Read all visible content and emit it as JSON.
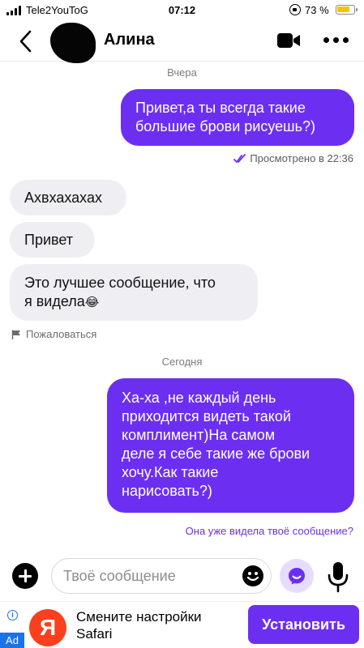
{
  "status_bar": {
    "carrier": "Tele2YouToG",
    "time": "07:12",
    "battery_percent": "73 %",
    "battery_color": "#f2c500"
  },
  "header": {
    "contact_name": "Алина",
    "back_icon": "chevron-left-icon",
    "video_icon": "video-camera-icon",
    "more_icon": "more-horizontal-icon"
  },
  "chat": {
    "date_yesterday": "Вчера",
    "date_today": "Сегодня",
    "messages": [
      {
        "direction": "out",
        "lines": [
          "Привет,а ты всегда такие",
          "большие брови рисуешь?)"
        ]
      },
      {
        "direction": "in",
        "lines": [
          "Ахвхахахах"
        ]
      },
      {
        "direction": "in",
        "lines": [
          "Привет"
        ]
      },
      {
        "direction": "in",
        "lines": [
          "Это лучшее сообщение, что",
          "я видела"
        ],
        "emoji": "😂"
      },
      {
        "direction": "out",
        "lines": [
          "Ха-ха ,не каждый день",
          "приходится видеть такой",
          "комплимент)На самом",
          "деле я себе такие же брови",
          "хочу.Как такие",
          "нарисовать?)"
        ]
      }
    ],
    "seen_status": "Просмотрено в 22:36",
    "report_link": "Пожаловаться",
    "seen_question": "Она уже видела твоё сообщение?"
  },
  "input_bar": {
    "placeholder": "Твоё сообщение",
    "value": ""
  },
  "ad": {
    "info_icon": "i",
    "label": "Ad",
    "logo_letter": "Я",
    "text_line1": "Смените настройки",
    "text_line2": "Safari",
    "button_label": "Установить"
  },
  "colors": {
    "accent": "#6c2ff2",
    "incoming_bubble": "#efeff3",
    "ad_logo": "#fc3f1d",
    "ad_label": "#1a73e8"
  }
}
